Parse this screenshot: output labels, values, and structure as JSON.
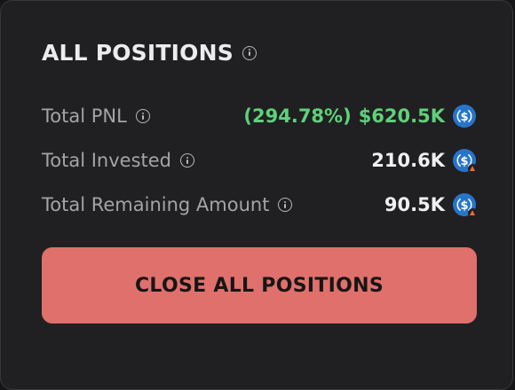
{
  "panel": {
    "title": "ALL POSITIONS"
  },
  "rows": [
    {
      "label": "Total PNL",
      "percent": "(294.78%)",
      "value": "$620.5K",
      "token_icon": "usdc-icon"
    },
    {
      "label": "Total Invested",
      "value": "210.6K",
      "token_icon": "usdc-icon"
    },
    {
      "label": "Total Remaining Amount",
      "value": "90.5K",
      "token_icon": "usdc-icon"
    }
  ],
  "actions": {
    "close_all_label": "CLOSE ALL POSITIONS"
  },
  "colors": {
    "panel_bg": "#202022",
    "pnl_positive": "#5fd17a",
    "close_button": "#e0706b",
    "usdc_blue": "#2775ca"
  }
}
